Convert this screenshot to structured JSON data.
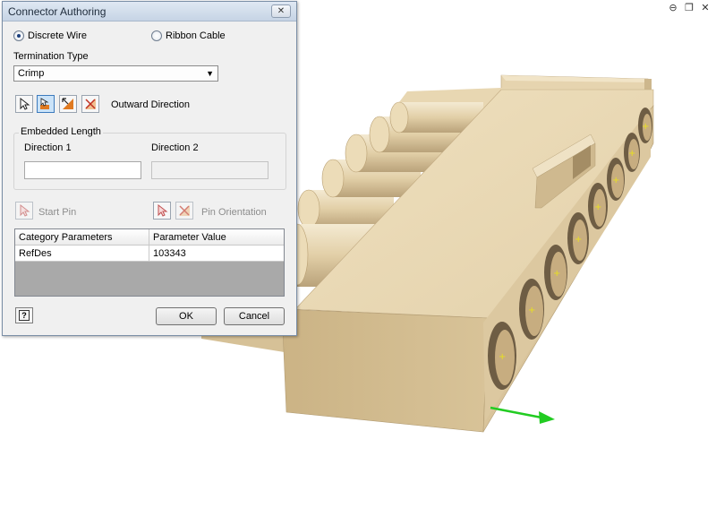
{
  "dialog": {
    "title": "Connector Authoring",
    "close_label": "✕",
    "wire_options": [
      {
        "label": "Discrete Wire",
        "checked": true
      },
      {
        "label": "Ribbon Cable",
        "checked": false
      }
    ],
    "termination": {
      "label": "Termination Type",
      "value": "Crimp"
    },
    "outward_direction_label": "Outward Direction",
    "embedded_length": {
      "label": "Embedded Length",
      "direction1_label": "Direction 1",
      "direction1_value": "",
      "direction2_label": "Direction 2",
      "direction2_value": ""
    },
    "start_pin_label": "Start Pin",
    "pin_orientation_label": "Pin Orientation",
    "table": {
      "headers": [
        "Category Parameters",
        "Parameter Value"
      ],
      "rows": [
        [
          "RefDes",
          "103343"
        ]
      ]
    },
    "help_label": "?",
    "ok_label": "OK",
    "cancel_label": "Cancel"
  },
  "window_controls": [
    "⊖",
    "❐",
    "✕"
  ],
  "icons": {
    "select": "cursor-arrow-icon",
    "outward": "outward-direction-icon",
    "flip": "flip-direction-icon",
    "clear": "clear-direction-icon"
  },
  "colors": {
    "model_face": "#ecdcb8",
    "model_side": "#cdb68c",
    "model_dark": "#b09a72",
    "axis_arrow": "#22cc22",
    "pin_marker": "#e8e020"
  }
}
